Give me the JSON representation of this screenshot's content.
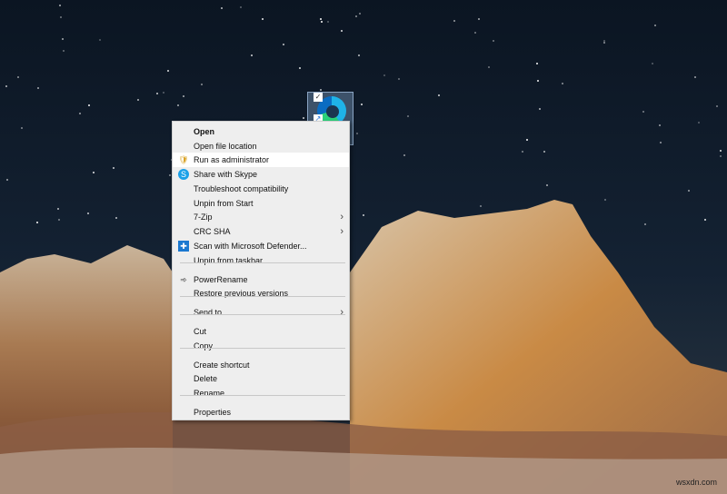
{
  "desktop": {
    "icon_name": "Microsoft Edge shortcut",
    "watermark": "wsxdn.com"
  },
  "menu": {
    "items": [
      {
        "label": "Open",
        "bold": true
      },
      {
        "label": "Open file location"
      },
      {
        "label": "Run as administrator",
        "icon": "uac-shield-icon",
        "highlighted": true
      },
      {
        "label": "Share with Skype",
        "icon": "skype-icon"
      },
      {
        "label": "Troubleshoot compatibility"
      },
      {
        "label": "Unpin from Start"
      },
      {
        "label": "7-Zip",
        "submenu": true
      },
      {
        "label": "CRC SHA",
        "submenu": true
      },
      {
        "label": "Scan with Microsoft Defender...",
        "icon": "defender-icon"
      },
      {
        "label": "Unpin from taskbar"
      },
      {
        "label": "PowerRename",
        "icon": "powerrename-icon"
      },
      {
        "label": "Restore previous versions"
      },
      {
        "label": "Send to",
        "submenu": true
      },
      {
        "label": "Cut"
      },
      {
        "label": "Copy"
      },
      {
        "label": "Create shortcut"
      },
      {
        "label": "Delete"
      },
      {
        "label": "Rename"
      },
      {
        "label": "Properties"
      }
    ]
  }
}
